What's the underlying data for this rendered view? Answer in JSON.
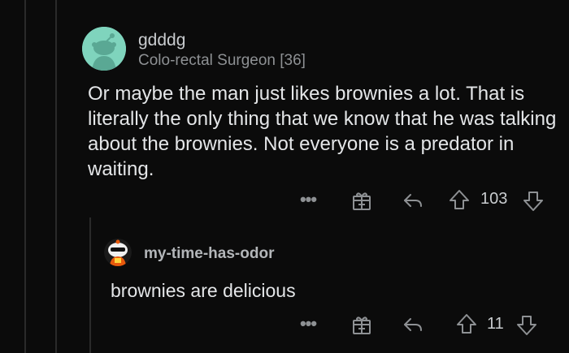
{
  "comment": {
    "username": "gdddg",
    "flair": "Colo-rectal Surgeon [36]",
    "body": "Or maybe the man just likes brownies a lot. That is literally the only thing that we know that he was talking about the brownies. Not everyone is a predator in waiting.",
    "votes": "103"
  },
  "reply": {
    "username": "my-time-has-odor",
    "body": "brownies are delicious",
    "votes": "11"
  },
  "icons": {
    "more": "more-options-icon",
    "award": "award-gift-icon",
    "reply": "reply-arrow-icon",
    "upvote": "upvote-icon",
    "downvote": "downvote-icon"
  },
  "colors": {
    "background": "#0b0b0b",
    "avatar_main": "#7fd4bd",
    "text": "#e4e6e8",
    "muted": "#8e9194"
  }
}
